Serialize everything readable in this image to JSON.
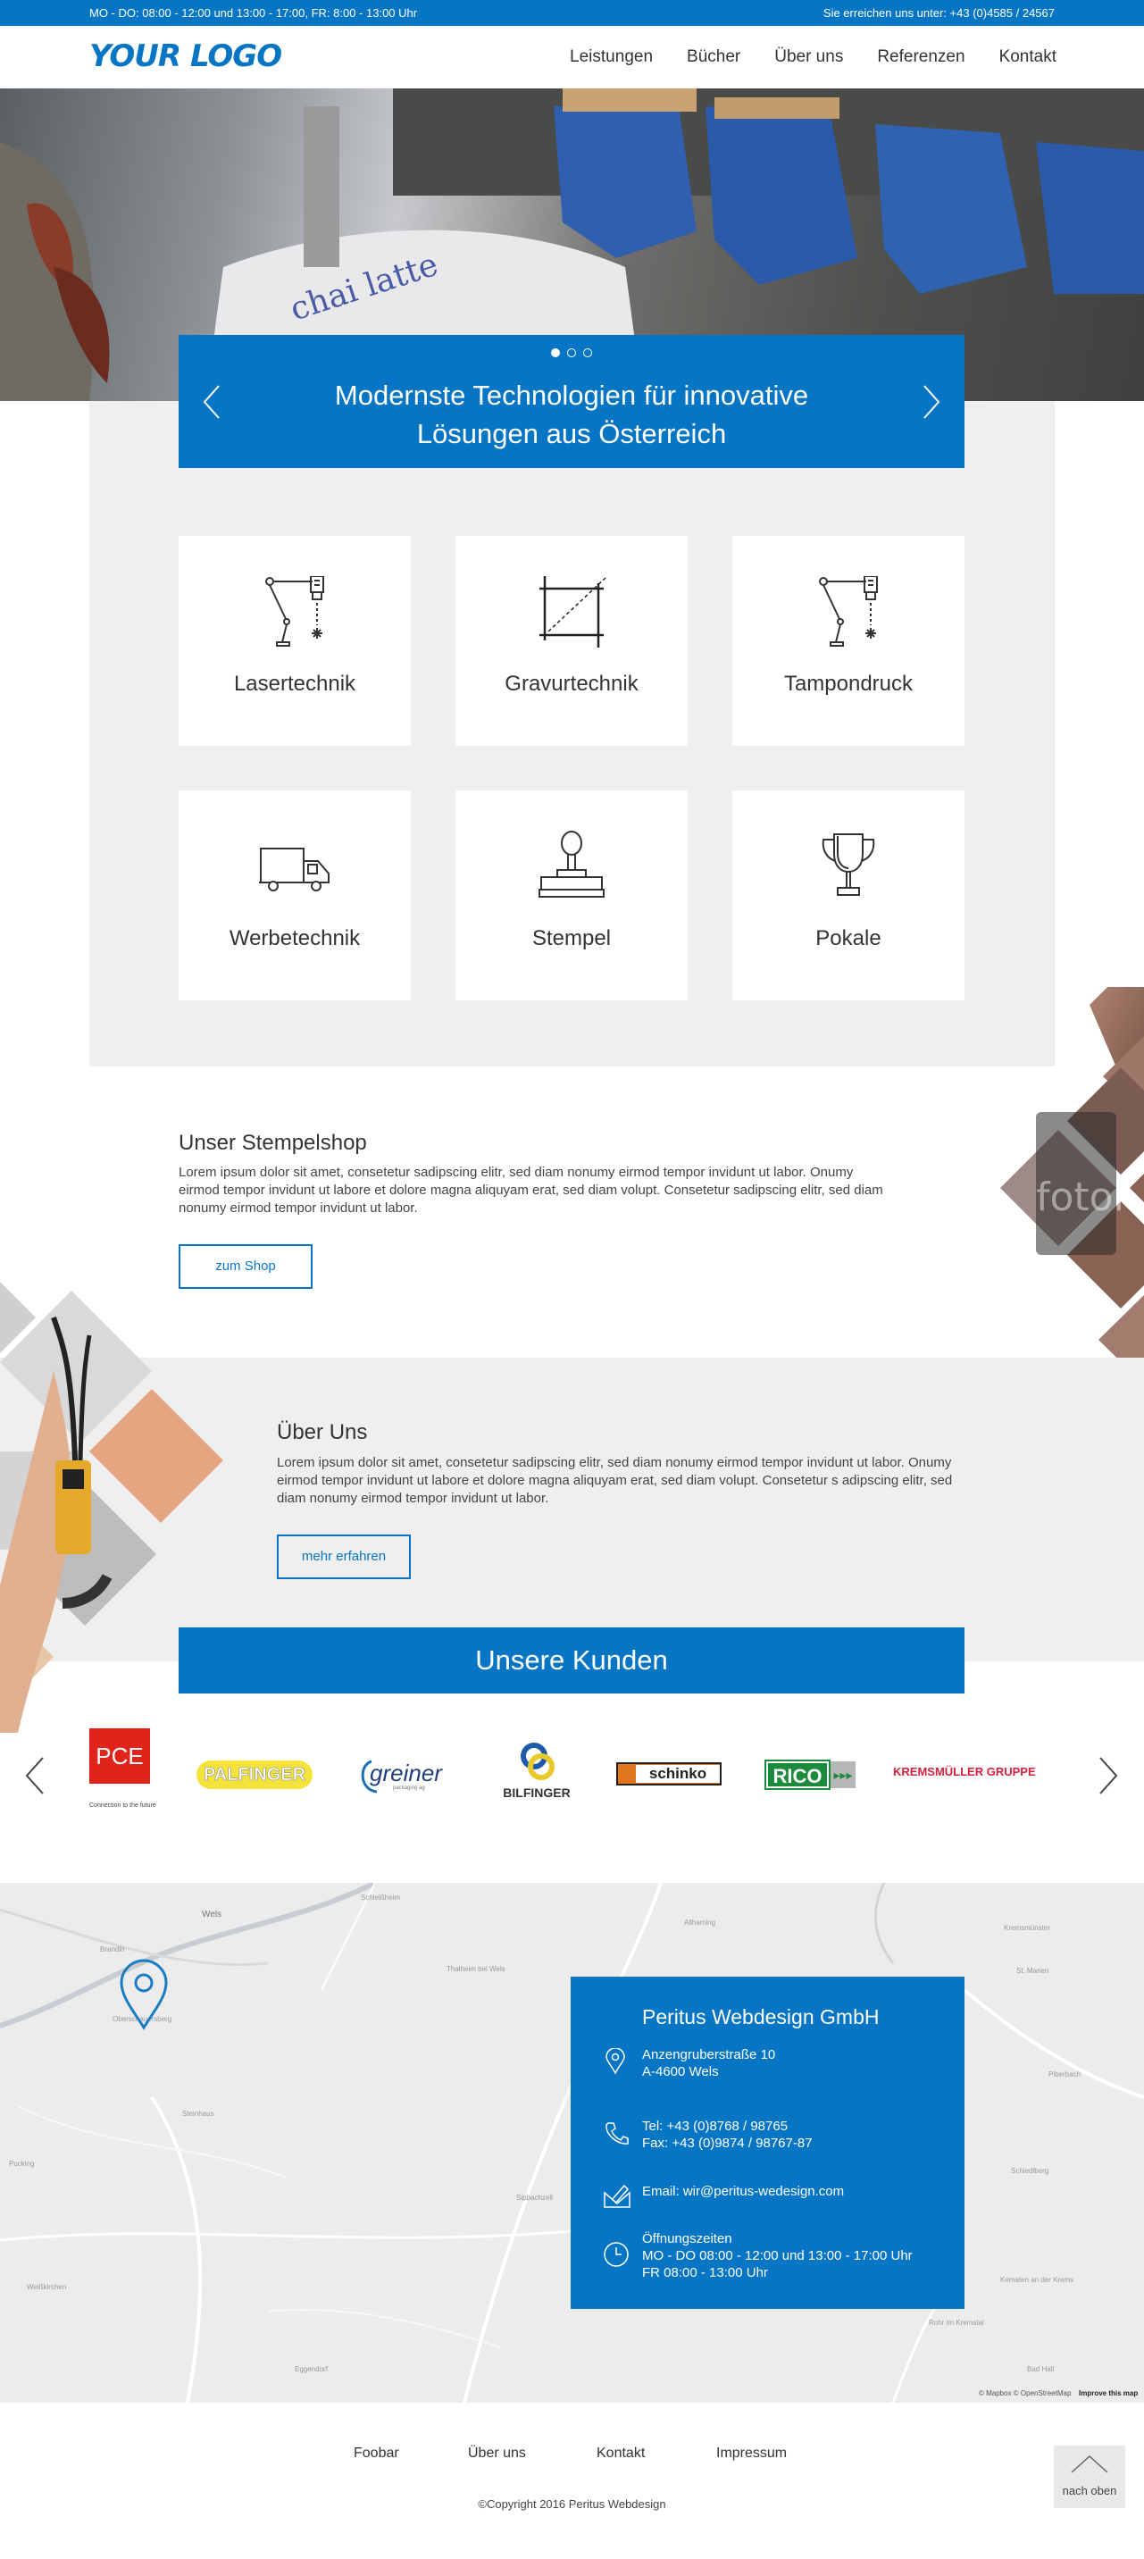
{
  "topbar": {
    "hours": "MO - DO: 08:00 - 12:00 und 13:00 - 17:00,  FR: 8:00 - 13:00 Uhr",
    "contact": "Sie erreichen uns unter: +43 (0)4585 / 24567"
  },
  "header": {
    "logo": "YOUR LOGO",
    "nav": [
      "Leistungen",
      "Bücher",
      "Über uns",
      "Referenzen",
      "Kontakt"
    ]
  },
  "slider": {
    "title_line1": "Modernste Technologien für innovative",
    "title_line2": "Lösungen aus Österreich",
    "slides": 3,
    "active_slide": 1
  },
  "services": [
    {
      "label": "Lasertechnik",
      "icon": "laser-arm-icon"
    },
    {
      "label": "Gravurtechnik",
      "icon": "engraving-frame-icon"
    },
    {
      "label": "Tampondruck",
      "icon": "laser-arm-icon"
    },
    {
      "label": "Werbetechnik",
      "icon": "truck-icon"
    },
    {
      "label": "Stempel",
      "icon": "stamp-icon"
    },
    {
      "label": "Pokale",
      "icon": "trophy-icon"
    }
  ],
  "stempelshop": {
    "title": "Unser Stempelshop",
    "text": "Lorem ipsum dolor sit amet, consetetur sadipscing elitr, sed diam nonumy eirmod tempor invidunt ut labor. Onumy eirmod tempor invidunt ut labore et dolore magna aliquyam erat, sed diam volupt. Consetetur sadipscing elitr, sed diam nonumy eirmod tempor invidunt ut labor.",
    "button": "zum Shop"
  },
  "ueber_uns": {
    "title": "Über Uns",
    "text": "Lorem ipsum dolor sit amet, consetetur sadipscing elitr, sed diam nonumy eirmod tempor invidunt ut labor. Onumy eirmod tempor invidunt ut labore et dolore magna aliquyam erat, sed diam volupt. Consetetur s adipscing elitr, sed diam nonumy eirmod tempor invidunt ut labor.",
    "button": "mehr erfahren"
  },
  "kunden": {
    "title": "Unsere Kunden",
    "logos": [
      "PCE",
      "PALFINGER",
      "greiner",
      "BILFINGER",
      "schinko",
      "RICO",
      "KREMSMÜLLER GRUPPE"
    ],
    "pce_tagline": "Connection to the future",
    "greiner_sub": "packaging ag"
  },
  "contact": {
    "company": "Peritus Webdesign GmbH",
    "address_line1": "Anzengruberstraße 10",
    "address_line2": "A-4600 Wels",
    "tel": "Tel: +43 (0)8768 / 98765",
    "fax": "Fax: +43 (0)9874 / 98767-87",
    "email": "Email: wir@peritus-wedesign.com",
    "hours_title": "Öffnungszeiten",
    "hours_line1": "MO - DO 08:00 - 12:00 und 13:00 - 17:00 Uhr",
    "hours_line2": "FR 08:00 - 13:00 Uhr"
  },
  "map": {
    "attribution": "© Mapbox © OpenStreetMap",
    "improve": "Improve this map",
    "places": [
      "Wels",
      "Schleißheim",
      "Thalheim bei Wels",
      "Brandln",
      "Oberschauersberg",
      "Steinhaus",
      "Sipbachzell",
      "Kremsmünster",
      "St. Marien",
      "Piberbach",
      "Schiedlberg",
      "Pucking",
      "Weißkirchen",
      "Allhaming",
      "Eggendorf",
      "Rohr im Kremstal",
      "Kematen an der Krems",
      "Bad Hall"
    ]
  },
  "footer": {
    "links": [
      "Foobar",
      "Über uns",
      "Kontakt",
      "Impressum"
    ],
    "copyright": "©Copyright 2016 Peritus Webdesign",
    "back_to_top": "nach oben"
  },
  "colors": {
    "primary": "#0676c4",
    "light_gray": "#efefef"
  }
}
